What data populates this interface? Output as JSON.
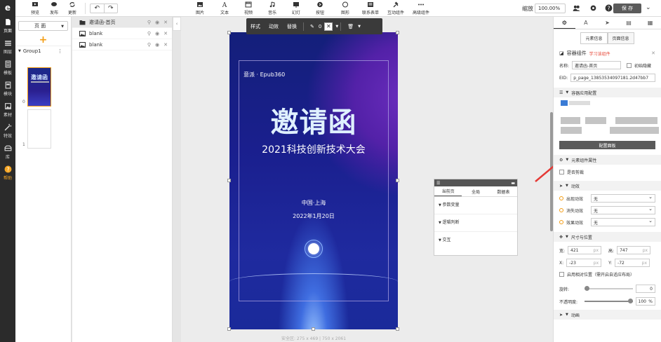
{
  "rail": {
    "logo": "e",
    "items": [
      {
        "label": "页面"
      },
      {
        "label": "图层"
      },
      {
        "label": "模板"
      },
      {
        "label": "模块"
      },
      {
        "label": "素材"
      },
      {
        "label": "特效"
      },
      {
        "label": "库"
      },
      {
        "label": "帮助"
      }
    ]
  },
  "toolbar": {
    "left": [
      {
        "label": "预览"
      },
      {
        "label": "发布"
      },
      {
        "label": "更新"
      }
    ],
    "undo": "↶",
    "redo": "↷",
    "tools": [
      {
        "label": "图片"
      },
      {
        "label": "文本"
      },
      {
        "label": "视频"
      },
      {
        "label": "音乐"
      },
      {
        "label": "幻灯"
      },
      {
        "label": "按钮"
      },
      {
        "label": "图形"
      },
      {
        "label": "联系表单"
      },
      {
        "label": "互动组件"
      },
      {
        "label": "高级组件"
      }
    ],
    "zoom_label": "缩放",
    "zoom_value": "100.00%",
    "save_label": "保 存"
  },
  "pages": {
    "select_label": "页 面",
    "add": "+",
    "group_label": "Group1",
    "group_more": "⋮",
    "thumbs": [
      {
        "num": "0",
        "title": "邀请函"
      },
      {
        "num": "1",
        "title": ""
      }
    ]
  },
  "layers": [
    {
      "label": "邀请函-首页",
      "type": "folder"
    },
    {
      "label": "blank",
      "type": "image"
    },
    {
      "label": "blank",
      "type": "image"
    }
  ],
  "float_bar": {
    "style": "样式",
    "anim": "动效",
    "replace": "替换",
    "value": "0"
  },
  "poster": {
    "logo": "意派 · Epub360",
    "title": "邀请函",
    "subtitle": "2021科技创新技术大会",
    "location": "中国·上海",
    "date": "2022年1月20日"
  },
  "canvas_footer": "安全区: 275 x 469 | 750 x 2061",
  "var_panel": {
    "tabs": [
      "当前页",
      "全局",
      "数据表"
    ],
    "sections": [
      "参数变量",
      "逻辑判断",
      "交互"
    ]
  },
  "props": {
    "subtabs": [
      "元素信息",
      "页面信息"
    ],
    "component_title": "容器组件",
    "learn": "学习该组件",
    "name_label": "名称:",
    "name_value": "邀请函-首页",
    "hide_label": "初始隐藏",
    "eid_label": "EID:",
    "eid_value": "p_page_13853534097181.2d47bb7",
    "app_config": "容器应用配置",
    "config_btn": "配置面板",
    "attr_head": "元素组件属性",
    "crop_label": "是否剪裁",
    "anim_head": "动效",
    "anims": [
      {
        "label": "出现动效",
        "value": "无"
      },
      {
        "label": "消失动效",
        "value": "无"
      },
      {
        "label": "效果动效",
        "value": "无"
      }
    ],
    "size_head": "尺寸与位置",
    "w_label": "宽:",
    "w": "421",
    "h_label": "高:",
    "h": "747",
    "x_label": "X:",
    "x": "-23",
    "y_label": "Y:",
    "y": "-72",
    "px": "px",
    "relative_label": "启用相对位置（需开启自适应布局）",
    "rotate_label": "旋转:",
    "rotate": "0",
    "opacity_label": "不透明度:",
    "opacity": "100",
    "pct": "%",
    "anim_foot": "动画"
  },
  "colors": {
    "accent": "#f39c12",
    "dark": "#2b2b2b",
    "poster_bg": "#1a1f8e"
  }
}
